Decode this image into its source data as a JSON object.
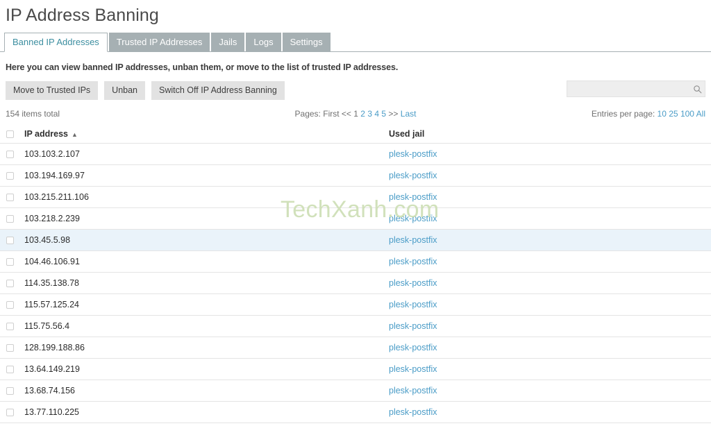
{
  "page": {
    "title": "IP Address Banning",
    "description": "Here you can view banned IP addresses, unban them, or move to the list of trusted IP addresses.",
    "watermark": "TechXanh.com"
  },
  "tabs": [
    {
      "label": "Banned IP Addresses",
      "active": true
    },
    {
      "label": "Trusted IP Addresses",
      "active": false
    },
    {
      "label": "Jails",
      "active": false
    },
    {
      "label": "Logs",
      "active": false
    },
    {
      "label": "Settings",
      "active": false
    }
  ],
  "toolbar": {
    "move_to_trusted_label": "Move to Trusted IPs",
    "unban_label": "Unban",
    "switch_off_label": "Switch Off IP Address Banning"
  },
  "search": {
    "value": "",
    "placeholder": "",
    "icon": "search-icon"
  },
  "meta": {
    "items_total": "154 items total",
    "pages_label": "Pages:",
    "pages_first": "First",
    "pages_prev": "<<",
    "pages_current": "1",
    "pages_links": [
      "2",
      "3",
      "4",
      "5"
    ],
    "pages_next": ">>",
    "pages_last": "Last",
    "entries_label": "Entries per page:",
    "entries_options": [
      "10",
      "25",
      "100",
      "All"
    ]
  },
  "table": {
    "columns": {
      "ip_address": "IP address",
      "used_jail": "Used jail",
      "sort_caret": "▲"
    },
    "rows": [
      {
        "ip": "103.103.2.107",
        "jail": "plesk-postfix",
        "highlight": false
      },
      {
        "ip": "103.194.169.97",
        "jail": "plesk-postfix",
        "highlight": false
      },
      {
        "ip": "103.215.211.106",
        "jail": "plesk-postfix",
        "highlight": false
      },
      {
        "ip": "103.218.2.239",
        "jail": "plesk-postfix",
        "highlight": false
      },
      {
        "ip": "103.45.5.98",
        "jail": "plesk-postfix",
        "highlight": true
      },
      {
        "ip": "104.46.106.91",
        "jail": "plesk-postfix",
        "highlight": false
      },
      {
        "ip": "114.35.138.78",
        "jail": "plesk-postfix",
        "highlight": false
      },
      {
        "ip": "115.57.125.24",
        "jail": "plesk-postfix",
        "highlight": false
      },
      {
        "ip": "115.75.56.4",
        "jail": "plesk-postfix",
        "highlight": false
      },
      {
        "ip": "128.199.188.86",
        "jail": "plesk-postfix",
        "highlight": false
      },
      {
        "ip": "13.64.149.219",
        "jail": "plesk-postfix",
        "highlight": false
      },
      {
        "ip": "13.68.74.156",
        "jail": "plesk-postfix",
        "highlight": false
      },
      {
        "ip": "13.77.110.225",
        "jail": "plesk-postfix",
        "highlight": false
      }
    ]
  },
  "colors": {
    "accent_link": "#4a9cc7",
    "active_tab_text": "#3c8ea0",
    "inactive_tab_bg": "#a6b0b3",
    "row_highlight": "#eaf3fa",
    "watermark": "#cfe0b8"
  }
}
